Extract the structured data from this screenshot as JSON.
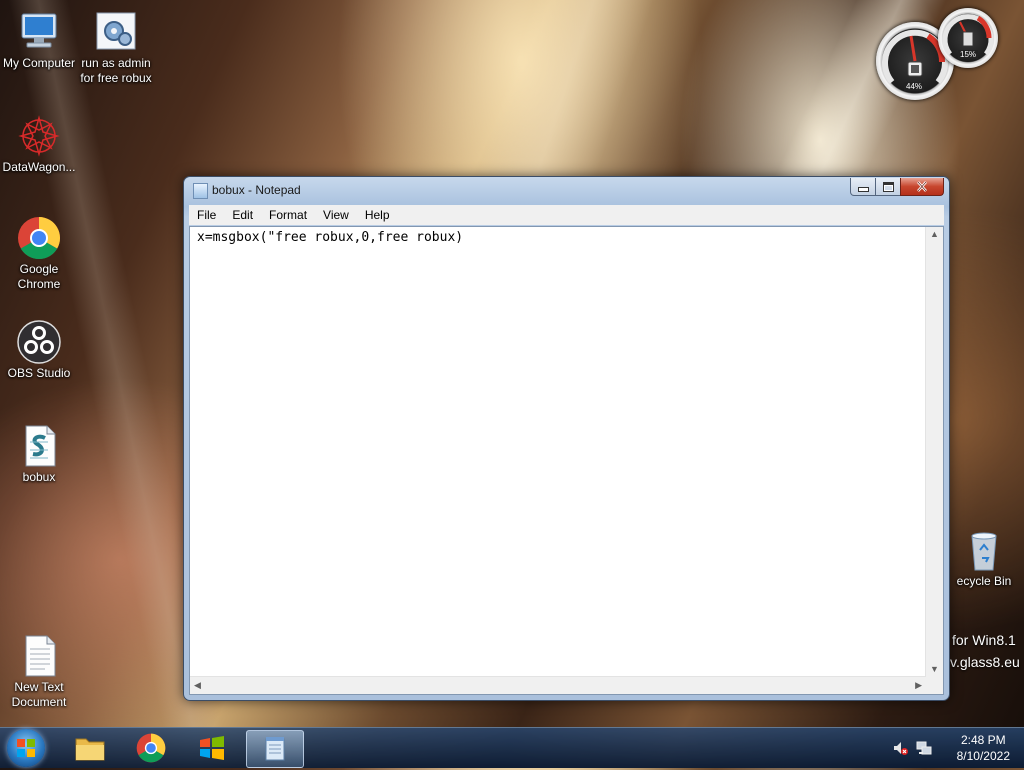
{
  "desktop": {
    "icons": [
      {
        "label_line1": "My Computer",
        "label_line2": ""
      },
      {
        "label_line1": "run as admin",
        "label_line2": "for free robux"
      },
      {
        "label_line1": "DataWagon...",
        "label_line2": ""
      },
      {
        "label_line1": "Google",
        "label_line2": "Chrome"
      },
      {
        "label_line1": "OBS Studio",
        "label_line2": ""
      },
      {
        "label_line1": "bobux",
        "label_line2": ""
      },
      {
        "label_line1": "New Text",
        "label_line2": "Document"
      },
      {
        "label_line1": "ecycle Bin",
        "label_line2": ""
      }
    ],
    "watermark_line1": "for Win8.1",
    "watermark_line2": "v.glass8.eu"
  },
  "gadget": {
    "cpu_percent": "44%",
    "memory_percent": "15%"
  },
  "notepad": {
    "title": "bobux - Notepad",
    "menu": [
      "File",
      "Edit",
      "Format",
      "View",
      "Help"
    ],
    "content": "x=msgbox(\"free robux,0,free robux)"
  },
  "taskbar": {
    "time": "2:48 PM",
    "date": "8/10/2022"
  },
  "colors": {
    "accent": "#2a78c0",
    "close_button": "#c7462e"
  }
}
